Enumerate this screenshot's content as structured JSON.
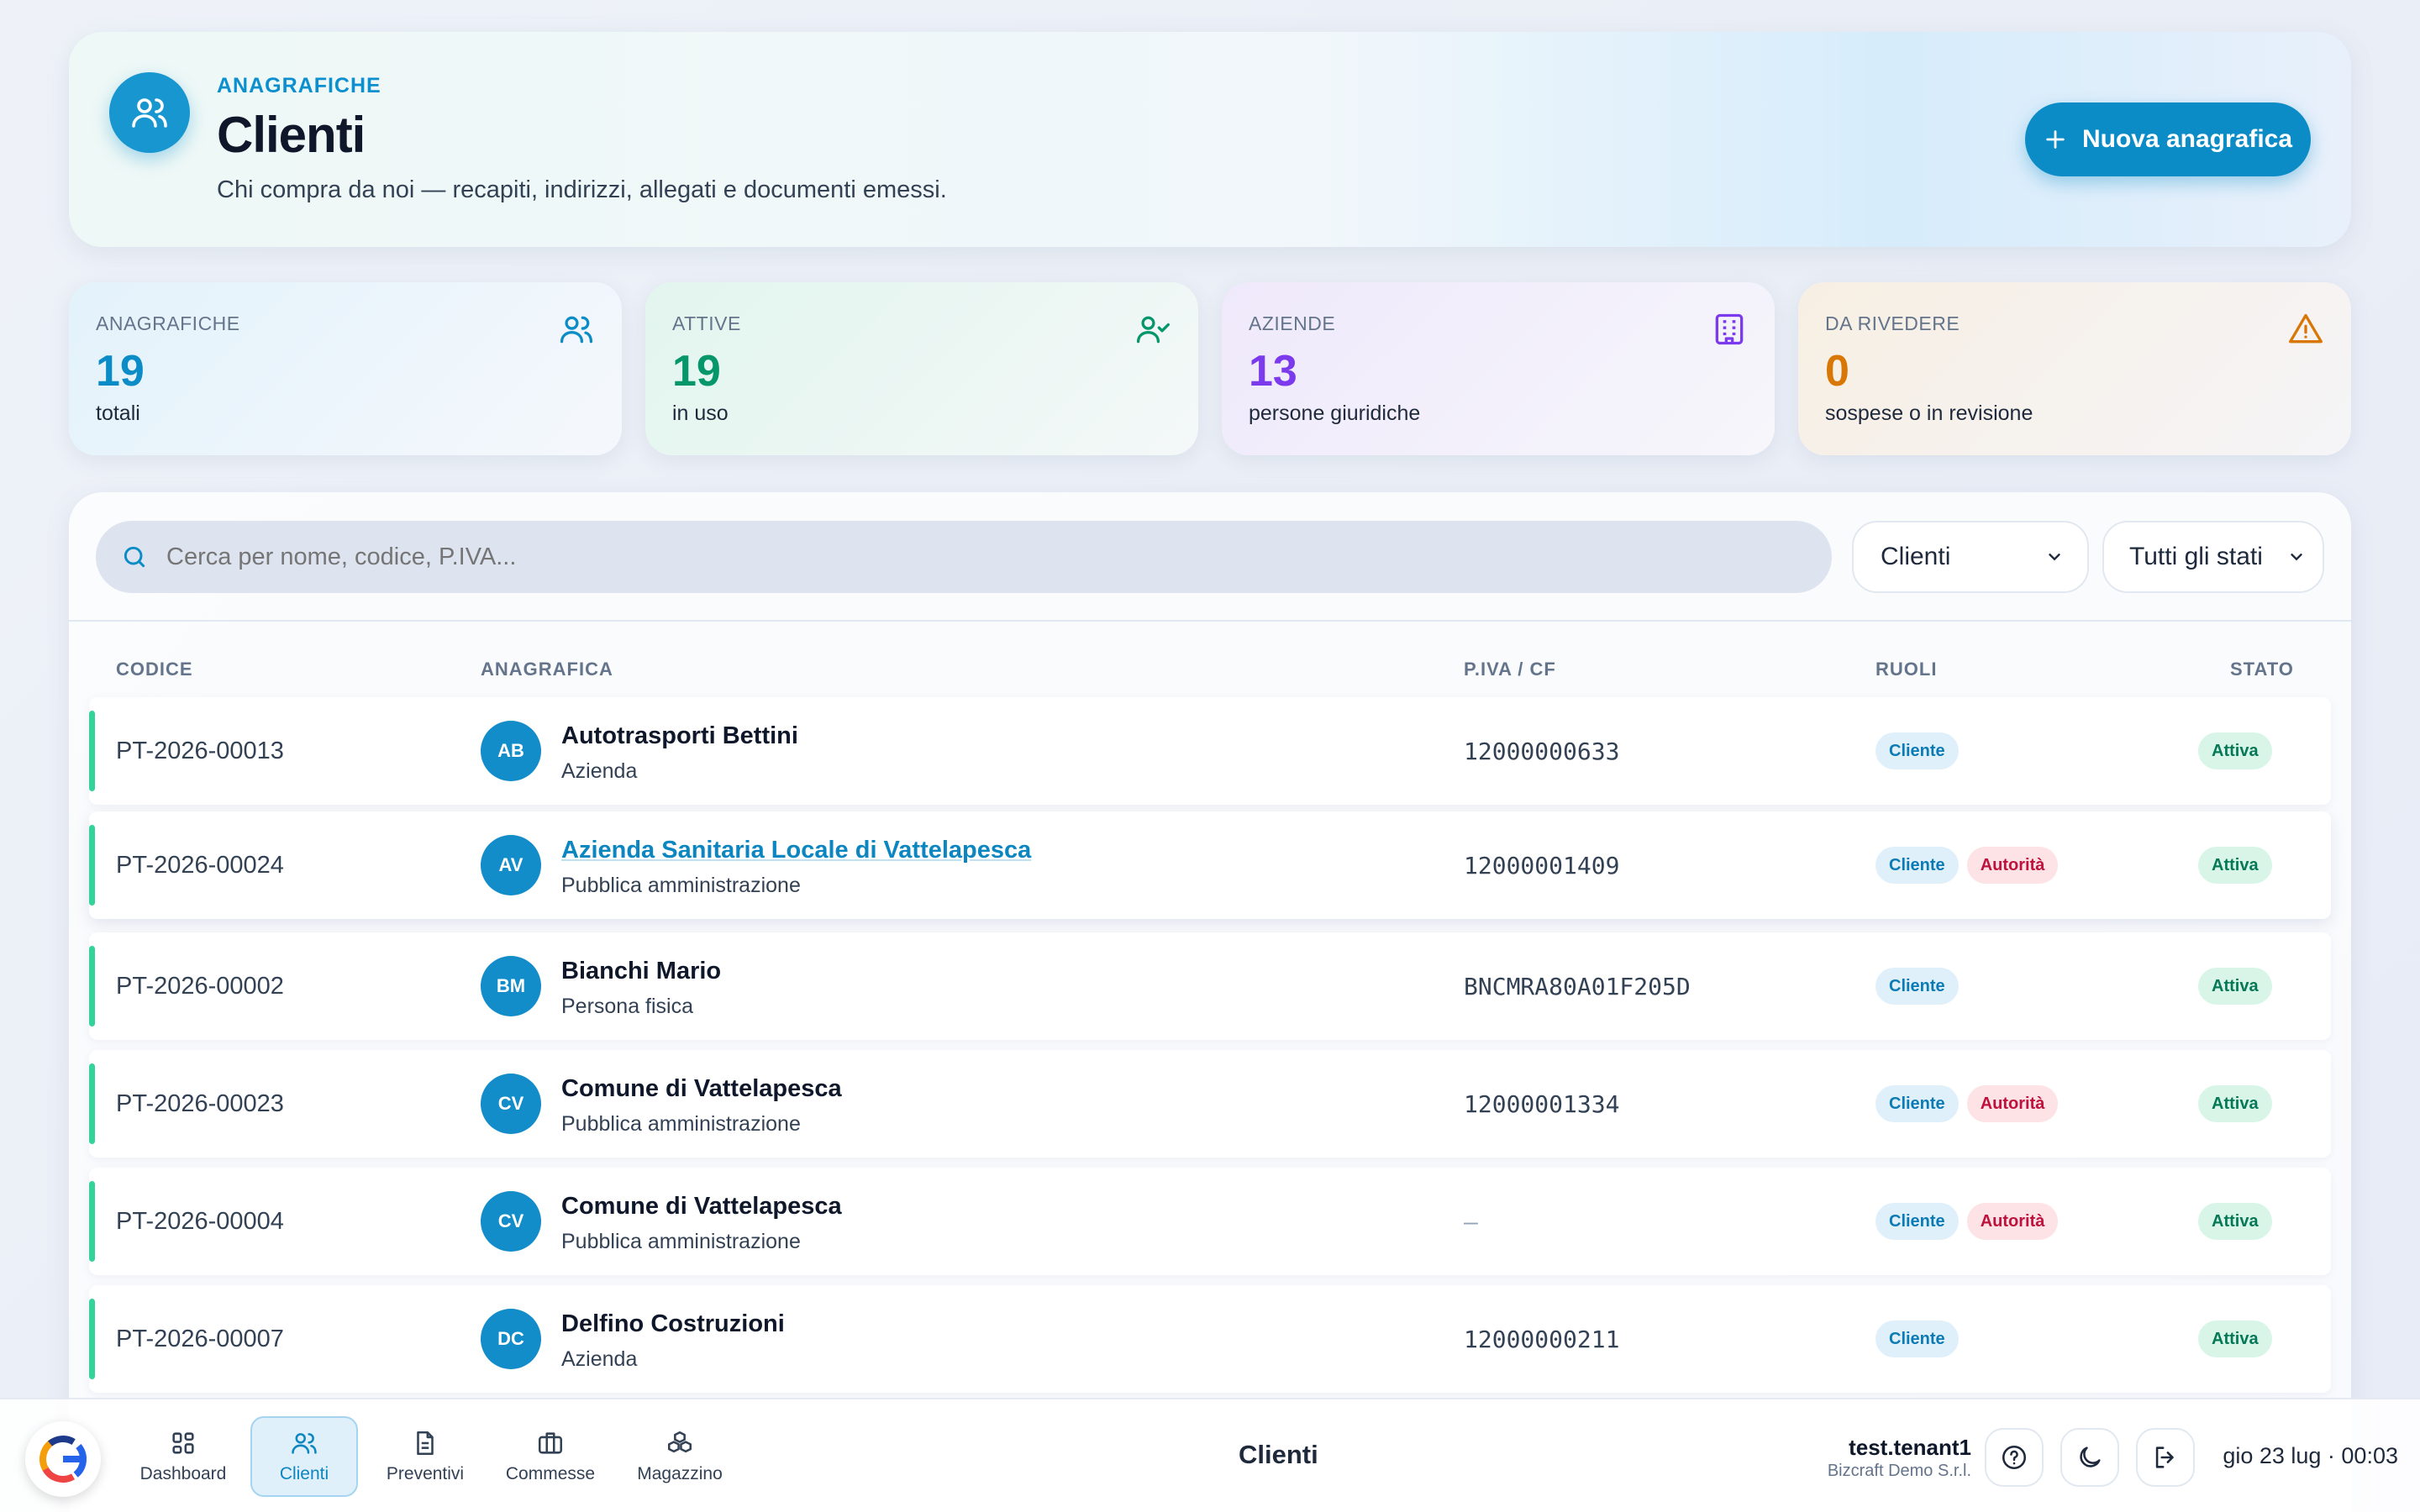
{
  "hero": {
    "kicker": "ANAGRAFICHE",
    "title": "Clienti",
    "subtitle": "Chi compra da noi — recapiti, indirizzi, allegati e documenti emessi.",
    "new_button": "Nuova anagrafica",
    "icon": "users-icon"
  },
  "stats": [
    {
      "label": "ANAGRAFICHE",
      "value": "19",
      "desc": "totali",
      "color": "#0b8cc7",
      "icon": "users-icon"
    },
    {
      "label": "ATTIVE",
      "value": "19",
      "desc": "in uso",
      "color": "#059669",
      "icon": "user-check-icon"
    },
    {
      "label": "AZIENDE",
      "value": "13",
      "desc": "persone giuridiche",
      "color": "#7c3aed",
      "icon": "building-icon"
    },
    {
      "label": "DA RIVEDERE",
      "value": "0",
      "desc": "sospese o in revisione",
      "color": "#d97706",
      "icon": "warning-icon"
    }
  ],
  "filters": {
    "search_placeholder": "Cerca per nome, codice, P.IVA...",
    "type_select": "Clienti",
    "status_select": "Tutti gli stati"
  },
  "table": {
    "headers": {
      "code": "CODICE",
      "entity": "ANAGRAFICA",
      "vat": "P.IVA / CF",
      "roles": "RUOLI",
      "status": "STATO"
    },
    "rows": [
      {
        "code": "PT-2026-00013",
        "initials": "AB",
        "name": "Autotrasporti Bettini",
        "type": "Azienda",
        "vat": "12000000633",
        "roles": [
          "Cliente"
        ],
        "status": "Attiva"
      },
      {
        "code": "PT-2026-00024",
        "initials": "AV",
        "name": "Azienda Sanitaria Locale di Vattelapesca",
        "type": "Pubblica amministrazione",
        "vat": "12000001409",
        "roles": [
          "Cliente",
          "Autorità"
        ],
        "status": "Attiva"
      },
      {
        "code": "PT-2026-00002",
        "initials": "BM",
        "name": "Bianchi Mario",
        "type": "Persona fisica",
        "vat": "BNCMRA80A01F205D",
        "roles": [
          "Cliente"
        ],
        "status": "Attiva"
      },
      {
        "code": "PT-2026-00023",
        "initials": "CV",
        "name": "Comune di Vattelapesca",
        "type": "Pubblica amministrazione",
        "vat": "12000001334",
        "roles": [
          "Cliente",
          "Autorità"
        ],
        "status": "Attiva"
      },
      {
        "code": "PT-2026-00004",
        "initials": "CV",
        "name": "Comune di Vattelapesca",
        "type": "Pubblica amministrazione",
        "vat": "—",
        "roles": [
          "Cliente",
          "Autorità"
        ],
        "status": "Attiva"
      },
      {
        "code": "PT-2026-00007",
        "initials": "DC",
        "name": "Delfino Costruzioni",
        "type": "Azienda",
        "vat": "12000000211",
        "roles": [
          "Cliente"
        ],
        "status": "Attiva"
      }
    ]
  },
  "dock": {
    "nav": [
      {
        "label": "Dashboard",
        "icon": "dashboard-icon"
      },
      {
        "label": "Clienti",
        "icon": "users-icon"
      },
      {
        "label": "Preventivi",
        "icon": "document-icon"
      },
      {
        "label": "Commesse",
        "icon": "briefcase-icon"
      },
      {
        "label": "Magazzino",
        "icon": "boxes-icon"
      }
    ],
    "title": "Clienti",
    "user": "test.tenant1",
    "org": "Bizcraft Demo S.r.l.",
    "clock": "gio 23 lug · 00:03"
  }
}
